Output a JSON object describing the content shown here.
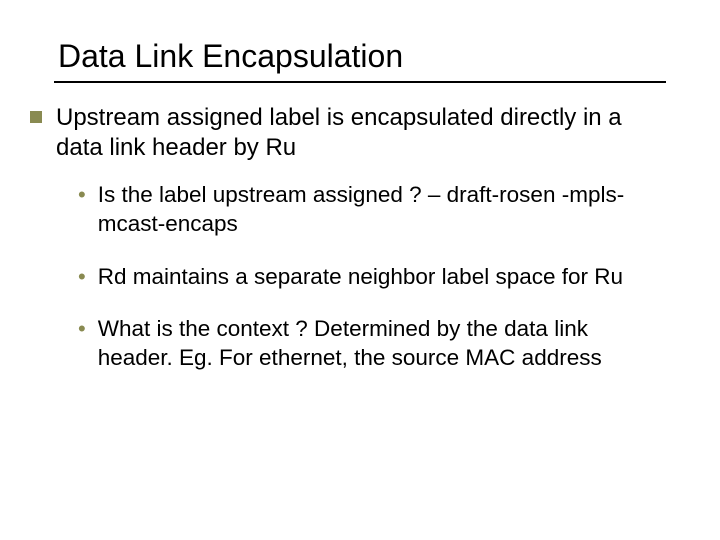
{
  "title": "Data Link Encapsulation",
  "main": {
    "text": "Upstream assigned label is encapsulated directly in a data link header by Ru",
    "subs": [
      "Is the label upstream assigned ? – draft-rosen -mpls-mcast-encaps",
      "Rd maintains a separate neighbor label space for Ru",
      "What is the context ? Determined by the data link header. Eg. For ethernet, the source MAC address"
    ]
  }
}
